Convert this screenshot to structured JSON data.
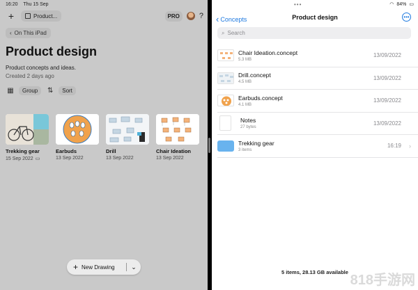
{
  "status": {
    "time": "16:20",
    "date": "Thu 15 Sep",
    "battery": "84%"
  },
  "toolbar": {
    "doc_name": "Product...",
    "pro": "PRO",
    "help": "?"
  },
  "breadcrumb": "On This iPad",
  "page": {
    "title": "Product design",
    "description": "Product concepts and ideas.",
    "created": "Created 2 days ago",
    "group_label": "Group",
    "sort_label": "Sort"
  },
  "cards": [
    {
      "name": "Trekking gear",
      "date": "15 Sep 2022"
    },
    {
      "name": "Earbuds",
      "date": "13 Sep 2022"
    },
    {
      "name": "Drill",
      "date": "13 Sep 2022"
    },
    {
      "name": "Chair Ideation",
      "date": "13 Sep 2022"
    }
  ],
  "new_drawing": {
    "label": "New Drawing"
  },
  "files": {
    "back_label": "Concepts",
    "title": "Product design",
    "search_placeholder": "Search",
    "rows": [
      {
        "name": "Chair Ideation.concept",
        "size": "5.3 MB",
        "date": "13/09/2022"
      },
      {
        "name": "Drill.concept",
        "size": "4.5 MB",
        "date": "13/09/2022"
      },
      {
        "name": "Earbuds.concept",
        "size": "4.1 MB",
        "date": "13/09/2022"
      },
      {
        "name": "Notes",
        "size": "27 bytes",
        "date": "13/09/2022"
      },
      {
        "name": "Trekking gear",
        "size": "3 items",
        "date": "16:19"
      }
    ],
    "footer": "5 items, 28.13 GB available"
  },
  "watermark": "818手游网"
}
